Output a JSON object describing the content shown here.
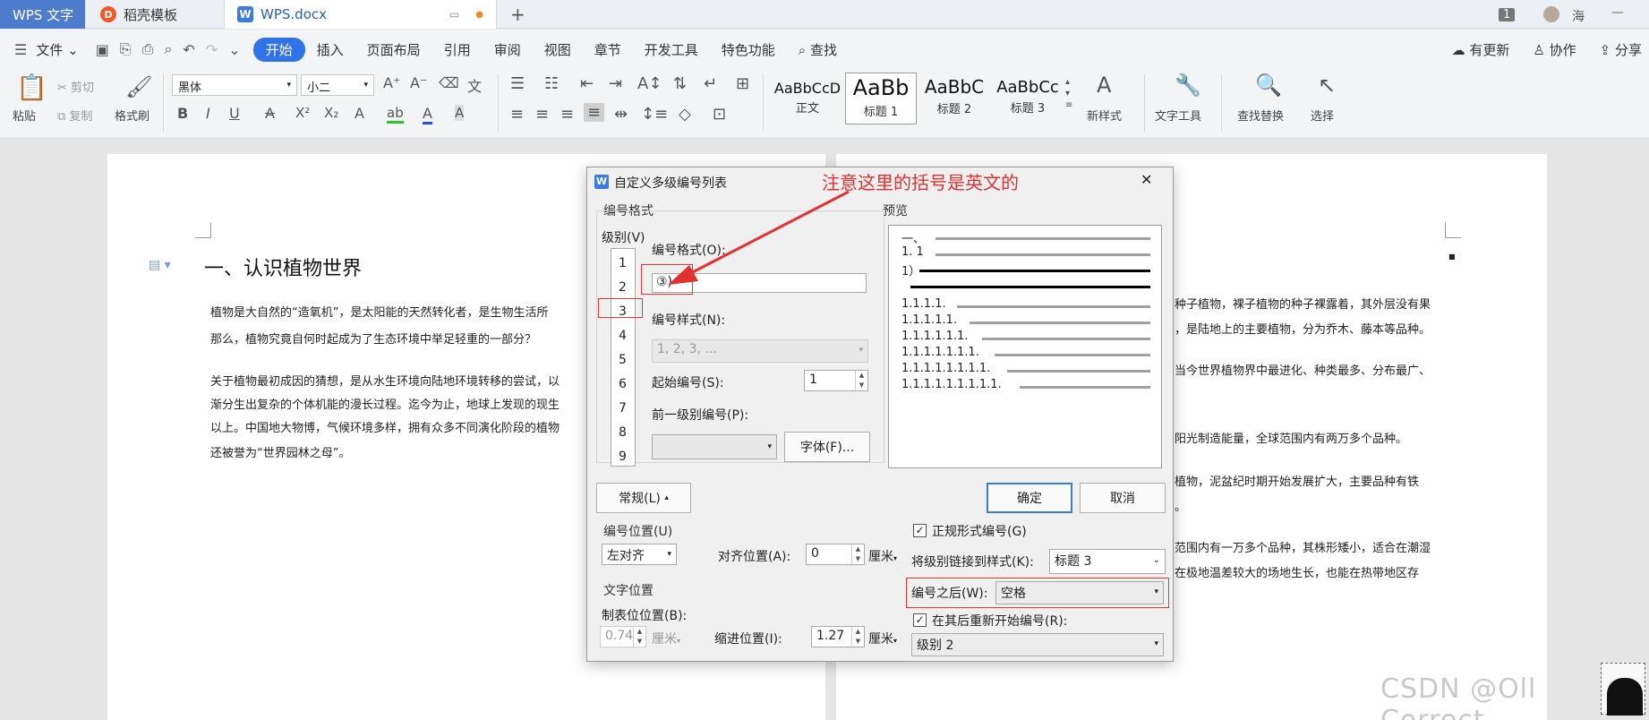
{
  "titlebar": {
    "app_tab": "WPS 文字",
    "template_tab": "稻壳模板",
    "doc_tab": "WPS.docx",
    "new_tab": "+",
    "window_count": "1",
    "user_name": "海",
    "minimize": "—"
  },
  "menubar": {
    "file": "文件",
    "items": [
      "开始",
      "插入",
      "页面布局",
      "引用",
      "审阅",
      "视图",
      "章节",
      "开发工具",
      "特色功能"
    ],
    "search": "查找",
    "right": [
      "有更新",
      "协作",
      "分享"
    ]
  },
  "ribbon": {
    "paste": "粘贴",
    "cut": "剪切",
    "copy": "复制",
    "format_painter": "格式刷",
    "font_name": "黑体",
    "font_size": "小二",
    "styles": [
      {
        "sample": "AaBbCcD",
        "name": "正文"
      },
      {
        "sample": "AaBb",
        "name": "标题 1"
      },
      {
        "sample": "AaBbC",
        "name": "标题 2"
      },
      {
        "sample": "AaBbCc",
        "name": "标题 3"
      }
    ],
    "new_style": "新样式",
    "text_tools": "文字工具",
    "find_replace": "查找替换",
    "select": "选择"
  },
  "document": {
    "heading": "一、认识植物世界",
    "left_paragraphs": [
      "植物是大自然的“造氧机”，是太阳能的天然转化者，是生物生活所",
      "那么，植物究竟自何时起成为了生态环境中举足轻重的一部分？",
      "关于植物最初成因的猜想，是从水生环境向陆地环境转移的尝试，以",
      "渐分生出复杂的个体机能的漫长过程。迄今为止，地球上发现的现生",
      "以上。中国地大物博，气候环境多样，拥有众多不同演化阶段的植物",
      "还被誉为“世界园林之母”。"
    ],
    "right_paragraphs": [
      "种子植物，裸子植物的种子裸露着，其外层没有果",
      "，是陆地上的主要植物，分为乔木、藤本等品种。",
      "当今世界植物界中最进化、种类最多、分布最广、",
      "阳光制造能量，全球范围内有两万多个品种。",
      "植物，泥盆纪时期开始发展扩大，主要品种有铁",
      "。",
      "范围内有一万多个品种，其株形矮小，适合在潮湿",
      "在极地温差较大的场地生长，也能在热带地区存"
    ]
  },
  "annotation": {
    "note": "注意这里的括号是英文的"
  },
  "dialog": {
    "title": "自定义多级编号列表",
    "close": "✕",
    "number_format_group": "编号格式",
    "level_label": "级别(V)",
    "levels": [
      "1",
      "2",
      "3",
      "4",
      "5",
      "6",
      "7",
      "8",
      "9"
    ],
    "format_label": "编号格式(O):",
    "format_value": "③)",
    "style_label": "编号样式(N):",
    "style_value": "1, 2, 3, ...",
    "start_label": "起始编号(S):",
    "start_value": "1",
    "prev_label": "前一级别编号(P):",
    "prev_value": "",
    "font_button": "字体(F)...",
    "preview_label": "预览",
    "preview_lines": [
      "一、",
      "1. 1",
      "1）",
      "",
      "1.1.1.1.",
      "1.1.1.1.1.",
      "1.1.1.1.1.1.",
      "1.1.1.1.1.1.1.",
      "1.1.1.1.1.1.1.1.",
      "1.1.1.1.1.1.1.1.1."
    ],
    "ok": "确定",
    "cancel": "取消",
    "normal_button": "常规(L)",
    "position_group": "编号位置(U)",
    "align_value": "左对齐",
    "align_pos_label": "对齐位置(A):",
    "align_pos_value": "0",
    "unit": "厘米",
    "text_pos_group": "文字位置",
    "tab_pos_label": "制表位位置(B):",
    "tab_pos_value": "0.74",
    "indent_label": "缩进位置(I):",
    "indent_value": "1.27",
    "legal_label": "正规形式编号(G)",
    "link_label": "将级别链接到样式(K):",
    "link_value": "标题 3",
    "after_label": "编号之后(W):",
    "after_value": "空格",
    "restart_label": "在其后重新开始编号(R):",
    "restart_value": "级别 2"
  },
  "watermark": "CSDN @Oll Correct",
  "colors": {
    "accent": "#2f73e6",
    "annotation_red": "#e33030",
    "wps_tab": "#4d7ccf"
  }
}
